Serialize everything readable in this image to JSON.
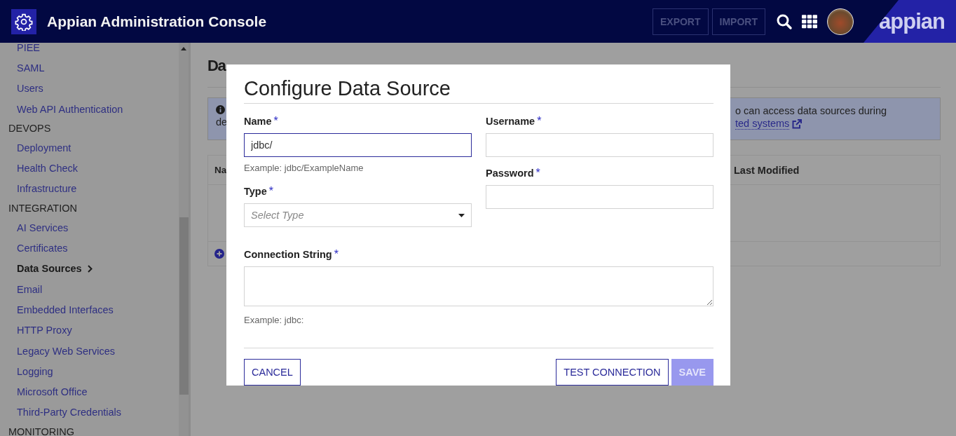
{
  "header": {
    "title": "Appian Administration Console",
    "logo": "appian",
    "buttons": [
      {
        "label": "EXPORT",
        "disabled": true
      },
      {
        "label": "IMPORT",
        "disabled": true
      }
    ]
  },
  "sidebar": {
    "items": [
      {
        "kind": "link",
        "label": "PIEE",
        "selected": false
      },
      {
        "kind": "link",
        "label": "SAML",
        "selected": false
      },
      {
        "kind": "link",
        "label": "Users",
        "selected": false
      },
      {
        "kind": "link",
        "label": "Web API Authentication",
        "selected": false
      },
      {
        "kind": "section",
        "label": "DEVOPS"
      },
      {
        "kind": "link",
        "label": "Deployment",
        "selected": false
      },
      {
        "kind": "link",
        "label": "Health Check",
        "selected": false
      },
      {
        "kind": "link",
        "label": "Infrastructure",
        "selected": false
      },
      {
        "kind": "section",
        "label": "INTEGRATION"
      },
      {
        "kind": "link",
        "label": "AI Services",
        "selected": false
      },
      {
        "kind": "link",
        "label": "Certificates",
        "selected": false
      },
      {
        "kind": "link",
        "label": "Data Sources",
        "selected": true
      },
      {
        "kind": "link",
        "label": "Email",
        "selected": false
      },
      {
        "kind": "link",
        "label": "Embedded Interfaces",
        "selected": false
      },
      {
        "kind": "link",
        "label": "HTTP Proxy",
        "selected": false
      },
      {
        "kind": "link",
        "label": "Legacy Web Services",
        "selected": false
      },
      {
        "kind": "link",
        "label": "Logging",
        "selected": false
      },
      {
        "kind": "link",
        "label": "Microsoft Office",
        "selected": false
      },
      {
        "kind": "link",
        "label": "Third-Party Credentials",
        "selected": false
      },
      {
        "kind": "section",
        "label": "MONITORING"
      }
    ]
  },
  "page": {
    "title": "Da",
    "info_start": "de",
    "info_text": "o can access data sources during",
    "info_link": "ted systems",
    "columns": [
      "Na",
      "Last Modified"
    ]
  },
  "dialog": {
    "title": "Configure Data Source",
    "required_mark": "*",
    "columns": [
      {
        "fields": [
          {
            "kind": "text",
            "label": "Name",
            "required": true,
            "value": "jdbc/",
            "focused": true,
            "hint": "Example: jdbc/ExampleName"
          },
          {
            "kind": "select",
            "label": "Type",
            "required": true,
            "placeholder": "Select Type"
          }
        ]
      },
      {
        "fields": [
          {
            "kind": "text",
            "label": "Username",
            "required": true,
            "focused": false
          },
          {
            "kind": "password",
            "label": "Password",
            "required": true,
            "focused": false
          }
        ]
      }
    ],
    "wide_field": {
      "kind": "textarea",
      "label": "Connection String",
      "required": true,
      "hint": "Example: jdbc:"
    },
    "left_buttons": [
      {
        "label": "CANCEL",
        "kind": "secondary",
        "disabled": false
      }
    ],
    "right_buttons": [
      {
        "label": "TEST CONNECTION",
        "kind": "secondary",
        "disabled": false
      },
      {
        "label": "SAVE",
        "kind": "primary",
        "disabled": true
      }
    ]
  }
}
